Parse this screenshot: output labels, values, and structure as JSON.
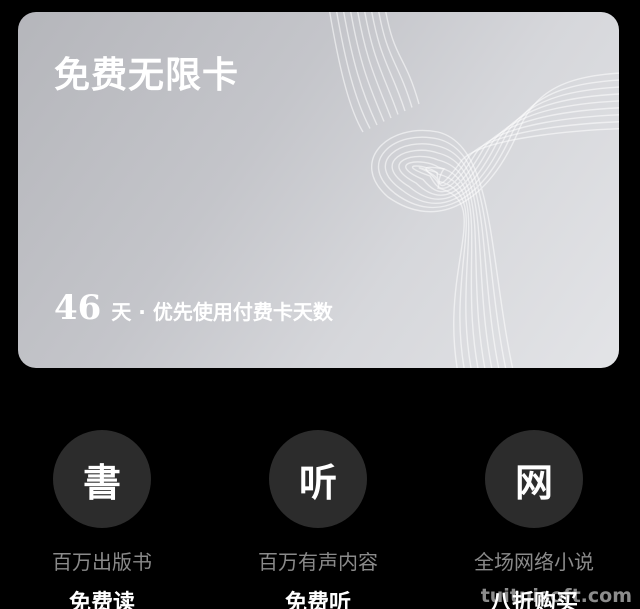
{
  "card": {
    "title": "免费无限卡",
    "days_number": "46",
    "days_text": "天 · 优先使用付费卡天数"
  },
  "features": [
    {
      "icon_char": "書",
      "subtitle": "百万出版书",
      "label": "免费读"
    },
    {
      "icon_char": "听",
      "subtitle": "百万有声内容",
      "label": "免费听"
    },
    {
      "icon_char": "网",
      "subtitle": "全场网络小说",
      "label": "八折购买"
    }
  ],
  "watermark": "tuituisoft.com",
  "colors": {
    "background": "#000000",
    "card_gradient_start": "#b5b6bb",
    "card_gradient_end": "#e3e4e7",
    "icon_circle": "#2c2c2c",
    "subtitle_text": "#8a8a8a"
  }
}
